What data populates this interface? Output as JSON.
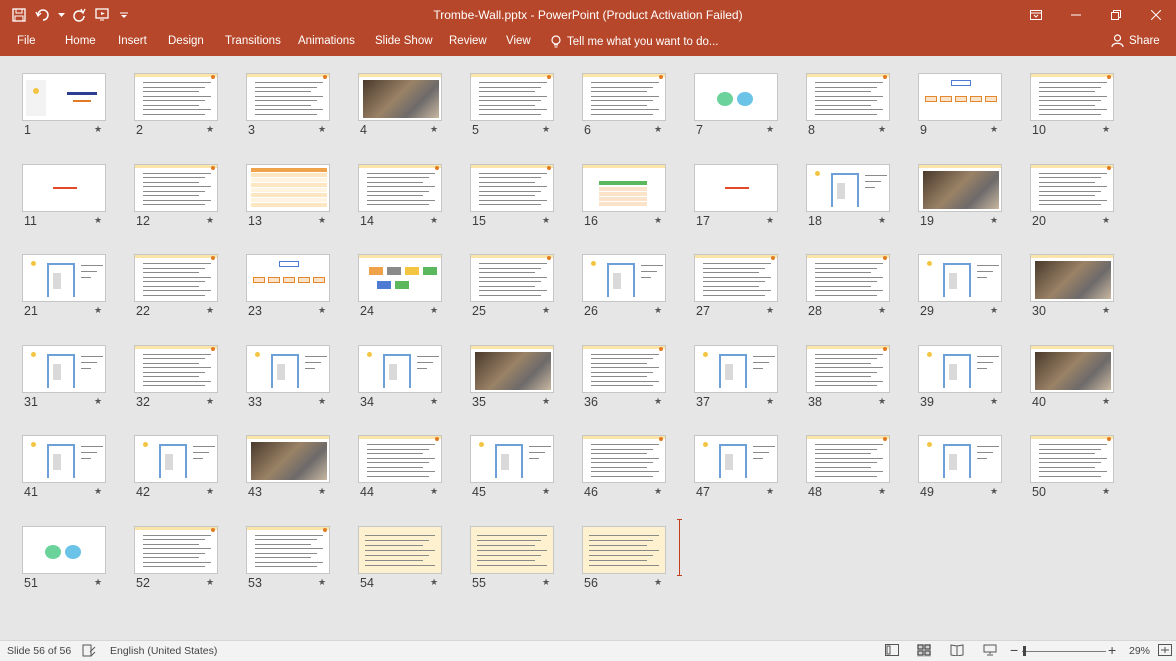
{
  "window": {
    "title": "Trombe-Wall.pptx - PowerPoint (Product Activation Failed)"
  },
  "ribbon": {
    "tabs": [
      "File",
      "Home",
      "Insert",
      "Design",
      "Transitions",
      "Animations",
      "Slide Show",
      "Review",
      "View"
    ],
    "tell_me": "Tell me what you want to do...",
    "share": "Share"
  },
  "slides": [
    {
      "n": "1",
      "kind": "title"
    },
    {
      "n": "2",
      "kind": "text"
    },
    {
      "n": "3",
      "kind": "text"
    },
    {
      "n": "4",
      "kind": "photo"
    },
    {
      "n": "5",
      "kind": "text"
    },
    {
      "n": "6",
      "kind": "text"
    },
    {
      "n": "7",
      "kind": "circles"
    },
    {
      "n": "8",
      "kind": "text"
    },
    {
      "n": "9",
      "kind": "diagram"
    },
    {
      "n": "10",
      "kind": "text"
    },
    {
      "n": "11",
      "kind": "section"
    },
    {
      "n": "12",
      "kind": "text"
    },
    {
      "n": "13",
      "kind": "table"
    },
    {
      "n": "14",
      "kind": "text"
    },
    {
      "n": "15",
      "kind": "text"
    },
    {
      "n": "16",
      "kind": "table-green"
    },
    {
      "n": "17",
      "kind": "section"
    },
    {
      "n": "18",
      "kind": "sketch"
    },
    {
      "n": "19",
      "kind": "photo"
    },
    {
      "n": "20",
      "kind": "text"
    },
    {
      "n": "21",
      "kind": "sketch"
    },
    {
      "n": "22",
      "kind": "text"
    },
    {
      "n": "23",
      "kind": "diagram"
    },
    {
      "n": "24",
      "kind": "boxes"
    },
    {
      "n": "25",
      "kind": "text"
    },
    {
      "n": "26",
      "kind": "sketch"
    },
    {
      "n": "27",
      "kind": "text"
    },
    {
      "n": "28",
      "kind": "text"
    },
    {
      "n": "29",
      "kind": "sketch"
    },
    {
      "n": "30",
      "kind": "photo"
    },
    {
      "n": "31",
      "kind": "sketch"
    },
    {
      "n": "32",
      "kind": "text"
    },
    {
      "n": "33",
      "kind": "sketch"
    },
    {
      "n": "34",
      "kind": "sketch"
    },
    {
      "n": "35",
      "kind": "photo"
    },
    {
      "n": "36",
      "kind": "text"
    },
    {
      "n": "37",
      "kind": "sketch"
    },
    {
      "n": "38",
      "kind": "text"
    },
    {
      "n": "39",
      "kind": "sketch"
    },
    {
      "n": "40",
      "kind": "photo"
    },
    {
      "n": "41",
      "kind": "sketch"
    },
    {
      "n": "42",
      "kind": "sketch"
    },
    {
      "n": "43",
      "kind": "photo"
    },
    {
      "n": "44",
      "kind": "text"
    },
    {
      "n": "45",
      "kind": "sketch"
    },
    {
      "n": "46",
      "kind": "text"
    },
    {
      "n": "47",
      "kind": "sketch"
    },
    {
      "n": "48",
      "kind": "text"
    },
    {
      "n": "49",
      "kind": "sketch"
    },
    {
      "n": "50",
      "kind": "text"
    },
    {
      "n": "51",
      "kind": "circles"
    },
    {
      "n": "52",
      "kind": "text"
    },
    {
      "n": "53",
      "kind": "text"
    },
    {
      "n": "54",
      "kind": "cream"
    },
    {
      "n": "55",
      "kind": "cream"
    },
    {
      "n": "56",
      "kind": "cream"
    }
  ],
  "status": {
    "slide_counter": "Slide 56 of 56",
    "language": "English (United States)",
    "zoom": "29%",
    "zoom_minus": "−",
    "zoom_plus": "+"
  },
  "colors": {
    "accent": "#b7472a",
    "sorter_bg": "#e6e6e6",
    "insertion_cursor": "#c43e1c"
  }
}
